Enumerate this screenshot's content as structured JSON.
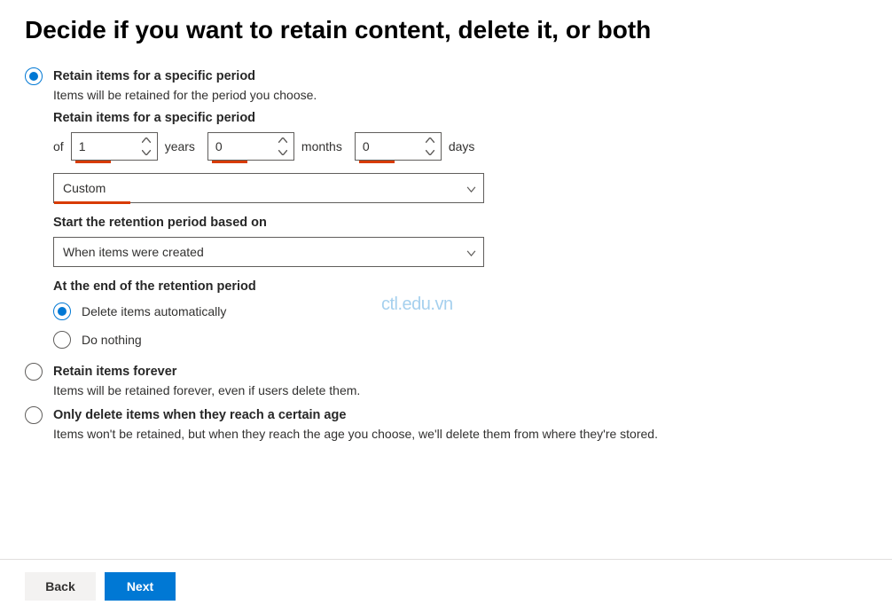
{
  "title": "Decide if you want to retain content, delete it, or both",
  "options": {
    "retain_period": {
      "label": "Retain items for a specific period",
      "desc": "Items will be retained for the period you choose."
    },
    "retain_forever": {
      "label": "Retain items forever",
      "desc": "Items will be retained forever, even if users delete them."
    },
    "delete_only": {
      "label": "Only delete items when they reach a certain age",
      "desc": "Items won't be retained, but when they reach the age you choose, we'll delete them from where they're stored."
    }
  },
  "period": {
    "section_label": "Retain items for a specific period",
    "of": "of",
    "years_value": "1",
    "years_label": "years",
    "months_value": "0",
    "months_label": "months",
    "days_value": "0",
    "days_label": "days",
    "preset_value": "Custom"
  },
  "start": {
    "label": "Start the retention period based on",
    "value": "When items were created"
  },
  "end": {
    "label": "At the end of the retention period",
    "delete_auto": "Delete items automatically",
    "do_nothing": "Do nothing"
  },
  "buttons": {
    "back": "Back",
    "next": "Next"
  },
  "watermark": "ctl.edu.vn"
}
